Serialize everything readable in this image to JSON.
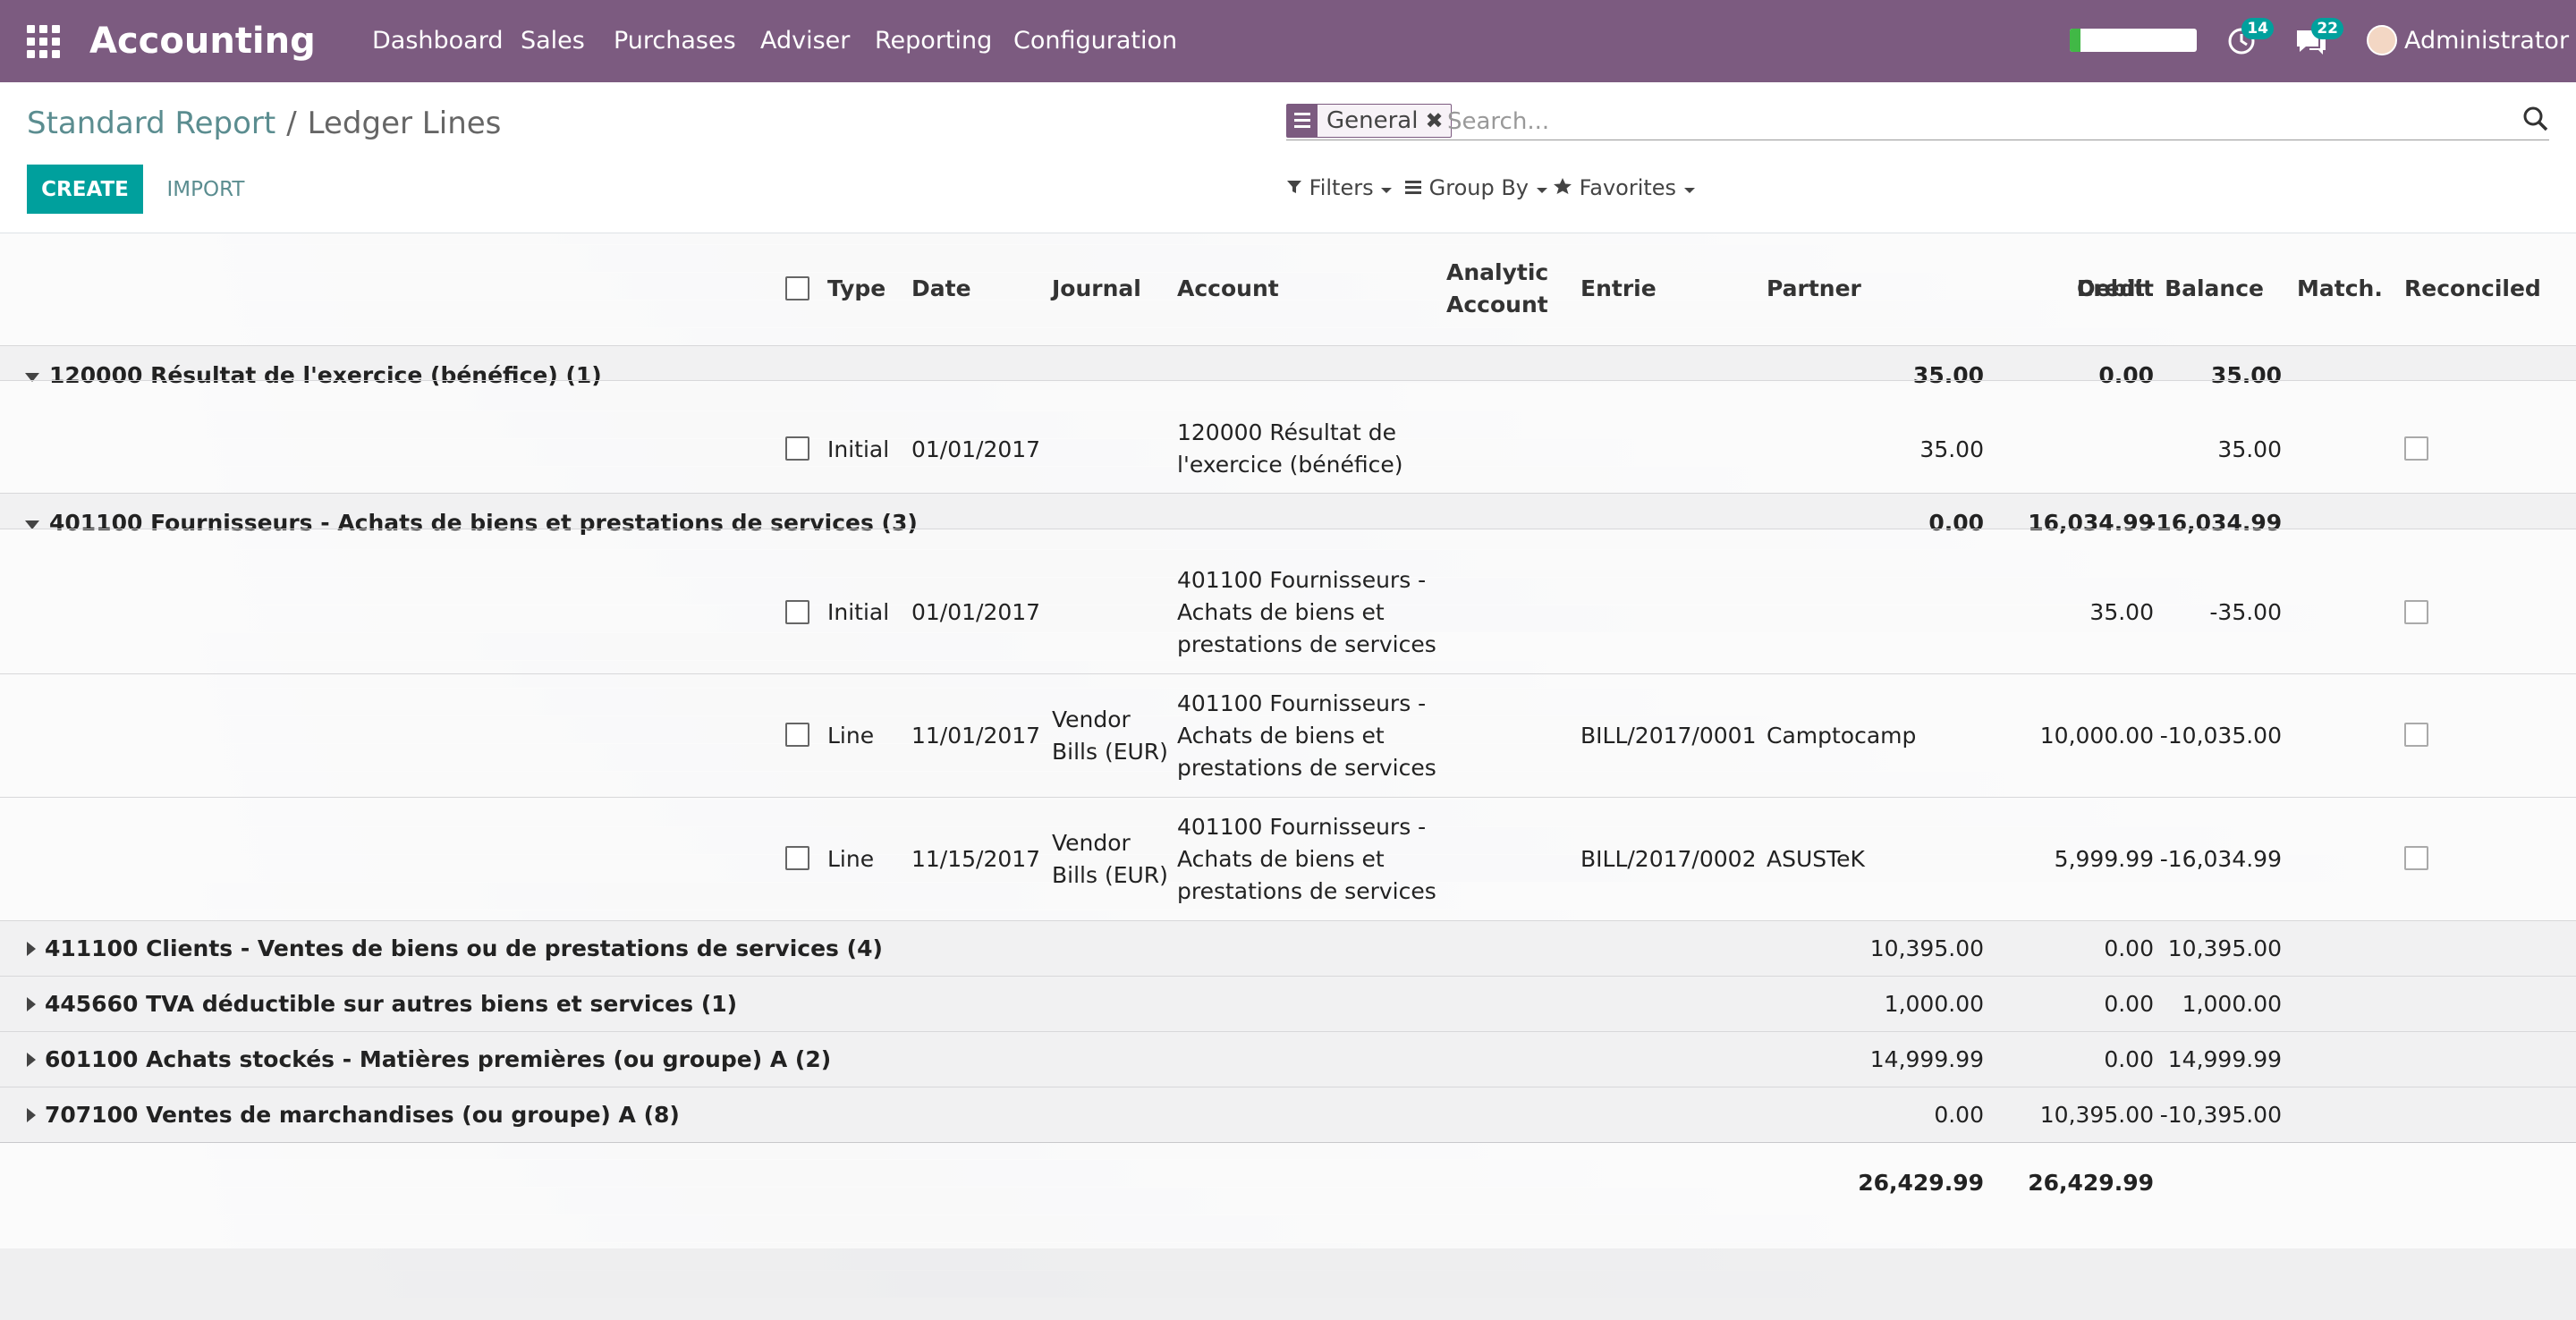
{
  "navbar": {
    "app_title": "Accounting",
    "menu": [
      "Dashboard",
      "Sales",
      "Purchases",
      "Adviser",
      "Reporting",
      "Configuration"
    ],
    "activity_count": "14",
    "message_count": "22",
    "user_name": "Administrator",
    "colors": {
      "bar": "#7c5b80",
      "badge": "#00a09d"
    }
  },
  "breadcrumb": {
    "parent": "Standard Report",
    "separator": "/",
    "current": "Ledger Lines"
  },
  "buttons": {
    "create": "CREATE",
    "import": "IMPORT"
  },
  "search": {
    "facet": "General",
    "facet_remove": "✖",
    "placeholder": "Search...",
    "filters": "Filters",
    "group_by": "Group By",
    "favorites": "Favorites"
  },
  "table": {
    "headers": {
      "type": "Type",
      "date": "Date",
      "journal": "Journal",
      "account": "Account",
      "analytic_1": "Analytic",
      "analytic_2": "Account",
      "entrie": "Entrie",
      "partner": "Partner",
      "debit": "Debit",
      "credit": "Credit",
      "balance": "Balance",
      "match": "Match.",
      "reconciled": "Reconciled"
    },
    "groups": [
      {
        "label": "120000 Résultat de l'exercice (bénéfice) (1)",
        "debit": "35.00",
        "credit": "0.00",
        "balance": "35.00",
        "expanded": true
      },
      {
        "label": "401100 Fournisseurs - Achats de biens et prestations de services (3)",
        "debit": "0.00",
        "credit": "16,034.99",
        "balance": "-16,034.99",
        "expanded": true
      },
      {
        "label": "411100 Clients - Ventes de biens ou de prestations de services (4)",
        "debit": "10,395.00",
        "credit": "0.00",
        "balance": "10,395.00",
        "expanded": false
      },
      {
        "label": "445660 TVA déductible sur autres biens et services (1)",
        "debit": "1,000.00",
        "credit": "0.00",
        "balance": "1,000.00",
        "expanded": false
      },
      {
        "label": "601100 Achats stockés - Matières premières (ou groupe) A (2)",
        "debit": "14,999.99",
        "credit": "0.00",
        "balance": "14,999.99",
        "expanded": false
      },
      {
        "label": "707100 Ventes de marchandises (ou groupe) A (8)",
        "debit": "0.00",
        "credit": "10,395.00",
        "balance": "-10,395.00",
        "expanded": false
      }
    ],
    "rows": [
      {
        "type": "Initial",
        "date": "01/01/2017",
        "journal": [
          "",
          ""
        ],
        "account": [
          "120000 Résultat de",
          "l'exercice (bénéfice)"
        ],
        "entrie": "",
        "partner": "",
        "debit": "35.00",
        "credit": "",
        "balance": "35.00",
        "reconciled": false
      },
      {
        "type": "Initial",
        "date": "01/01/2017",
        "journal": [
          "",
          ""
        ],
        "account": [
          "401100 Fournisseurs -",
          "Achats de biens et",
          "prestations de services"
        ],
        "entrie": "",
        "partner": "",
        "debit": "",
        "credit": "35.00",
        "balance": "-35.00",
        "reconciled": false
      },
      {
        "type": "Line",
        "date": "11/01/2017",
        "journal": [
          "Vendor",
          "Bills (EUR)"
        ],
        "account": [
          "401100 Fournisseurs -",
          "Achats de biens et",
          "prestations de services"
        ],
        "entrie": "BILL/2017/0001",
        "partner": "Camptocamp",
        "debit": "",
        "credit": "10,000.00",
        "balance": "-10,035.00",
        "reconciled": false
      },
      {
        "type": "Line",
        "date": "11/15/2017",
        "journal": [
          "Vendor",
          "Bills (EUR)"
        ],
        "account": [
          "401100 Fournisseurs -",
          "Achats de biens et",
          "prestations de services"
        ],
        "entrie": "BILL/2017/0002",
        "partner": "ASUSTeK",
        "debit": "",
        "credit": "5,999.99",
        "balance": "-16,034.99",
        "reconciled": false
      }
    ],
    "totals": {
      "debit": "26,429.99",
      "credit": "26,429.99"
    }
  }
}
